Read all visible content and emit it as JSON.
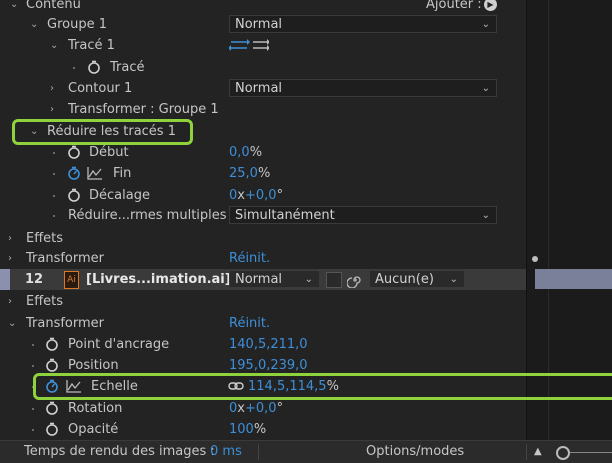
{
  "rows": {
    "contenu": "Contenu",
    "ajouter": "Ajouter :",
    "groupe1": "Groupe 1",
    "groupe1_mode": "Normal",
    "trace1": "Tracé 1",
    "trace": "Tracé",
    "contour1": "Contour 1",
    "contour1_mode": "Normal",
    "transformer_groupe": "Transformer : Groupe 1",
    "reduire": "Réduire les tracés 1",
    "debut": "Début",
    "debut_value": "0,0",
    "debut_unit": "%",
    "fin": "Fin",
    "fin_value": "25,0",
    "fin_unit": "%",
    "decalage": "Décalage",
    "decalage_value": "0",
    "decalage_x": "x",
    "decalage_value2": "+0,0",
    "decalage_unit": "°",
    "reduire_multi": "Réduire...rmes multiples",
    "reduire_multi_value": "Simultanément",
    "effets_inner": "Effets",
    "transformer_inner": "Transformer",
    "reinit_inner": "Réinit.",
    "layer_num": "12",
    "layer_name": "[Livres...imation.ai]",
    "layer_mode": "Normal",
    "layer_track": "Aucun(e)",
    "effets": "Effets",
    "transformer": "Transformer",
    "reinit": "Réinit.",
    "ancrage": "Point d'ancrage",
    "ancrage_value": "140,5,211,0",
    "position": "Position",
    "position_value": "195,0,239,0",
    "echelle": "Echelle",
    "echelle_value": "114,5,114,5",
    "echelle_unit": "%",
    "rotation": "Rotation",
    "rotation_value": "0",
    "rotation_x": "x",
    "rotation_value2": "+0,0",
    "rotation_unit": "°",
    "opacite": "Opacité",
    "opacite_value": "100",
    "opacite_unit": "%"
  },
  "status": {
    "render_label": "Temps de rendu des images :",
    "render_value": "0 ms",
    "options": "Options/modes"
  },
  "colors": {
    "value_blue": "#3d8fd8",
    "highlight_green": "#8ed33b",
    "layer_label": "#8a90ae"
  }
}
